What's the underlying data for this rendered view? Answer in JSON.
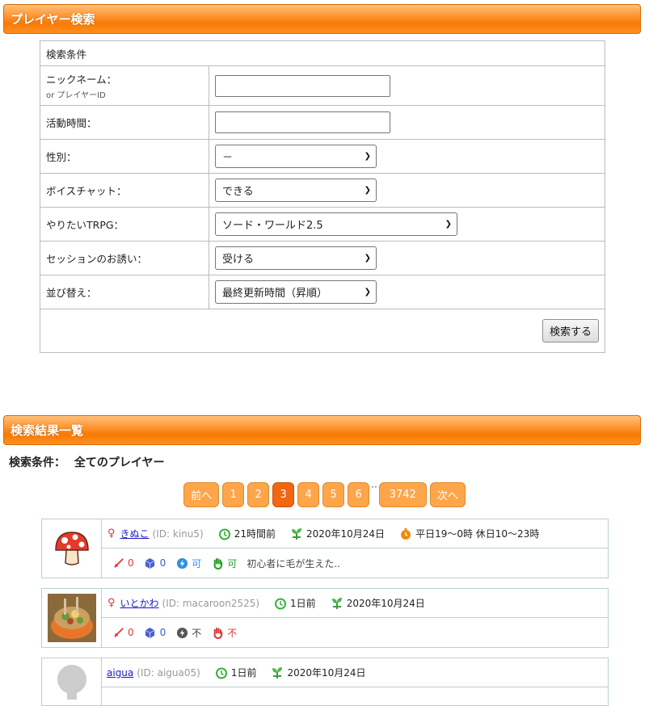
{
  "search_section": {
    "title": "プレイヤー検索",
    "conditions_header": "検索条件",
    "fields": {
      "nickname": {
        "label": "ニックネーム：",
        "sublabel": "or プレイヤーID",
        "value": ""
      },
      "active_time": {
        "label": "活動時間：",
        "value": ""
      },
      "gender": {
        "label": "性別：",
        "selected": "－"
      },
      "voice_chat": {
        "label": "ボイスチャット：",
        "selected": "できる"
      },
      "trpg": {
        "label": "やりたいTRPG：",
        "selected": "ソード・ワールド2.5"
      },
      "session_invite": {
        "label": "セッションのお誘い：",
        "selected": "受ける"
      },
      "sort": {
        "label": "並び替え：",
        "selected": "最終更新時間（昇順）"
      }
    },
    "search_button": "検索する"
  },
  "results_section": {
    "title": "検索結果一覧",
    "condition_label": "検索条件：",
    "condition_value": "全てのプレイヤー",
    "pagination": {
      "prev": "前へ",
      "pages": [
        "1",
        "2",
        "3",
        "4",
        "5",
        "6"
      ],
      "ellipsis": "··",
      "last": "3742",
      "next": "次へ",
      "current": "3"
    },
    "players": [
      {
        "name": "きぬこ",
        "id_text": "(ID: kinu5)",
        "last_active": "21時間前",
        "registered": "2020年10月24日",
        "schedule": "平日19～0時 休日10～23時",
        "gm_count": "0",
        "pl_count": "0",
        "voice": "可",
        "invite": "可",
        "comment": "初心者に毛が生えた.."
      },
      {
        "name": "いとかわ",
        "id_text": "(ID: macaroon2525)",
        "last_active": "1日前",
        "registered": "2020年10月24日",
        "gm_count": "0",
        "pl_count": "0",
        "voice": "不",
        "invite": "不"
      },
      {
        "name": "aigua",
        "id_text": "(ID: aigua05)",
        "last_active": "1日前",
        "registered": "2020年10月24日"
      }
    ]
  },
  "colors": {
    "header_orange": "#f77a05",
    "page_button": "#ffa54a",
    "page_active": "#f26611",
    "player_border": "#b8d2cf"
  }
}
